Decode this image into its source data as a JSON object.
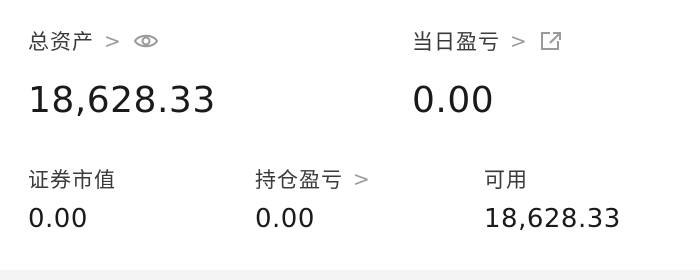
{
  "total_assets": {
    "label": "总资产",
    "value": "18,628.33",
    "chevron": ">",
    "icon": "eye-icon"
  },
  "daily_pnl": {
    "label": "当日盈亏",
    "value": "0.00",
    "chevron": ">",
    "icon": "external-link-icon"
  },
  "market_value": {
    "label": "证券市值",
    "value": "0.00"
  },
  "position_pnl": {
    "label": "持仓盈亏",
    "value": "0.00",
    "chevron": ">"
  },
  "available": {
    "label": "可用",
    "value": "18,628.33"
  },
  "colors": {
    "text": "#1a1a1a",
    "label": "#3a3a3a",
    "muted": "#9a9a9a"
  }
}
